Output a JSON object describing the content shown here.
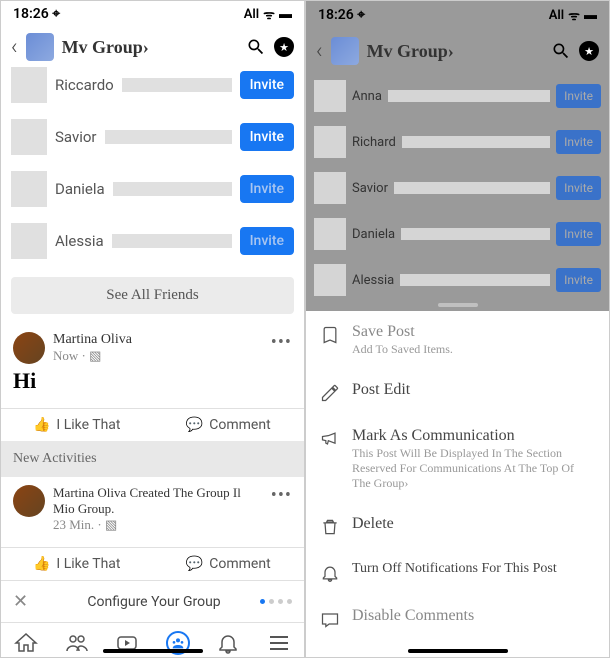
{
  "status": {
    "time": "18:26",
    "right": "All",
    "loc": "⌖"
  },
  "header": {
    "title": "Mv Group›"
  },
  "left": {
    "friends": [
      {
        "name": "Riccardo",
        "muted": false,
        "invite": "Invite"
      },
      {
        "name": "Savior",
        "muted": false,
        "invite": "Invite"
      },
      {
        "name": "Daniela",
        "muted": true,
        "invite": "Invite"
      },
      {
        "name": "Alessia",
        "muted": true,
        "invite": "Invite"
      }
    ],
    "see_all": "See All Friends",
    "post1": {
      "user": "Martina Oliva",
      "time": "Now · ▧",
      "body": "Hi",
      "like": "I Like That",
      "comment": "Comment"
    },
    "new_activities": "New Activities",
    "post2": {
      "user": "Martina Oliva Created The Group Il Mio Group.",
      "time": "23 Min. · ▧",
      "like": "I Like That",
      "comment": "Comment"
    },
    "config": "Configure Your Group"
  },
  "right": {
    "friends": [
      {
        "name": "Anna",
        "invite": "Invite"
      },
      {
        "name": "Richard",
        "invite": "Invite"
      },
      {
        "name": "Savior",
        "invite": "Invite"
      },
      {
        "name": "Daniela",
        "invite": "Invite"
      },
      {
        "name": "Alessia",
        "invite": "Invite"
      }
    ],
    "sheet": {
      "save": {
        "title": "Save Post",
        "sub": "Add To Saved Items."
      },
      "edit": {
        "title": "Post Edit"
      },
      "mark": {
        "title": "Mark As Communication",
        "sub": "This Post Will Be Displayed In The Section Reserved For Communications At The Top Of The Group›"
      },
      "delete": {
        "title": "Delete"
      },
      "notif": {
        "title": "Turn Off Notifications For This Post"
      },
      "disable": {
        "title": "Disable Comments"
      }
    }
  }
}
